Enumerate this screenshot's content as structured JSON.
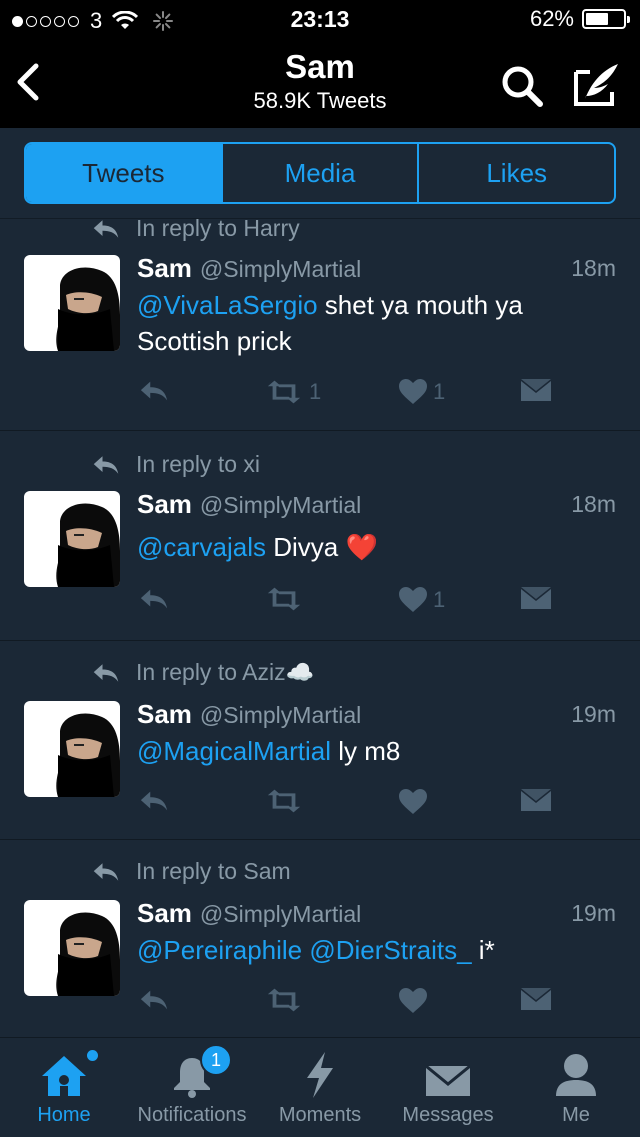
{
  "status_bar": {
    "signal_dots_filled": 1,
    "signal_dots_total": 5,
    "carrier": "3",
    "time": "23:13",
    "battery_percent": "62%",
    "battery_level": 0.62
  },
  "nav": {
    "title": "Sam",
    "subtitle": "58.9K Tweets",
    "back_icon": "chevron-left-icon",
    "search_icon": "search-icon",
    "compose_icon": "compose-tweet-icon"
  },
  "tabs": [
    {
      "label": "Tweets",
      "active": true
    },
    {
      "label": "Media",
      "active": false
    },
    {
      "label": "Likes",
      "active": false
    }
  ],
  "tweets": [
    {
      "reply_to": "In reply to Harry",
      "name": "Sam",
      "handle": "@SimplyMartial",
      "time": "18m",
      "mention": "@VivaLaSergio",
      "text": " shet ya mouth ya Scottish prick",
      "retweets": "1",
      "likes": "1"
    },
    {
      "reply_to": "In reply to xi",
      "name": "Sam",
      "handle": "@SimplyMartial",
      "time": "18m",
      "mention": "@carvajals",
      "text": " Divya ❤️",
      "retweets": "",
      "likes": "1"
    },
    {
      "reply_to": "In reply to Aziz☁️",
      "name": "Sam",
      "handle": "@SimplyMartial",
      "time": "19m",
      "mention": "@MagicalMartial",
      "text": " ly m8",
      "retweets": "",
      "likes": ""
    },
    {
      "reply_to": "In reply to Sam",
      "name": "Sam",
      "handle": "@SimplyMartial",
      "time": "19m",
      "mention": "@Pereiraphile @DierStraits_",
      "text": " i*",
      "retweets": "",
      "likes": ""
    }
  ],
  "tabbar": [
    {
      "label": "Home",
      "icon": "home-icon",
      "active": true
    },
    {
      "label": "Notifications",
      "icon": "bell-icon",
      "badge": "1"
    },
    {
      "label": "Moments",
      "icon": "lightning-icon"
    },
    {
      "label": "Messages",
      "icon": "envelope-icon"
    },
    {
      "label": "Me",
      "icon": "person-icon"
    }
  ],
  "colors": {
    "accent": "#1da1f2",
    "background": "#1b2836",
    "bar": "#000000",
    "muted": "#8899a6"
  }
}
